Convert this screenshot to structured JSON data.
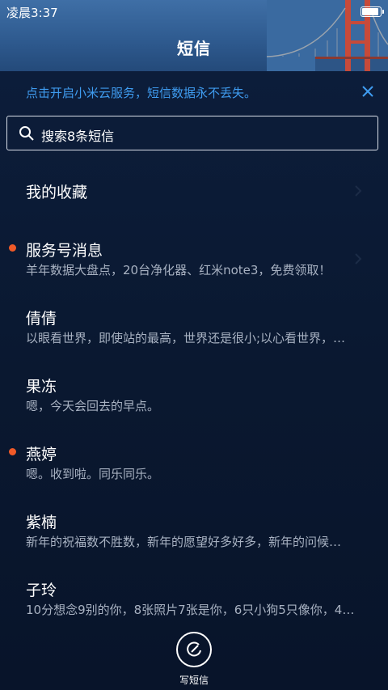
{
  "status": {
    "time": "凌晨3:37"
  },
  "header": {
    "title": "短信"
  },
  "banner": {
    "text": "点击开启小米云服务，短信数据永不丢失。"
  },
  "search": {
    "placeholder": "搜索8条短信"
  },
  "favorites": {
    "label": "我的收藏"
  },
  "conversations": [
    {
      "name": "服务号消息",
      "preview": "羊年数据大盘点，20台净化器、红米note3，免费领取！",
      "unread": true
    },
    {
      "name": "倩倩",
      "preview": "以眼看世界，即使站的最高，世界还是很小;以心看世界，…",
      "unread": false
    },
    {
      "name": "果冻",
      "preview": "嗯，今天会回去的早点。",
      "unread": false
    },
    {
      "name": "燕婷",
      "preview": "嗯。收到啦。同乐同乐。",
      "unread": true
    },
    {
      "name": "紫楠",
      "preview": "新年的祝福数不胜数，新年的愿望好多好多，新年的问候…",
      "unread": false
    },
    {
      "name": "子玲",
      "preview": "10分想念9别的你，8张照片7张是你，6只小狗5只像你，4…",
      "unread": false
    }
  ],
  "compose": {
    "label": "写短信"
  },
  "colors": {
    "accent": "#3f9cf0",
    "unread_dot": "#f05a28",
    "background": "#0b1a33"
  }
}
